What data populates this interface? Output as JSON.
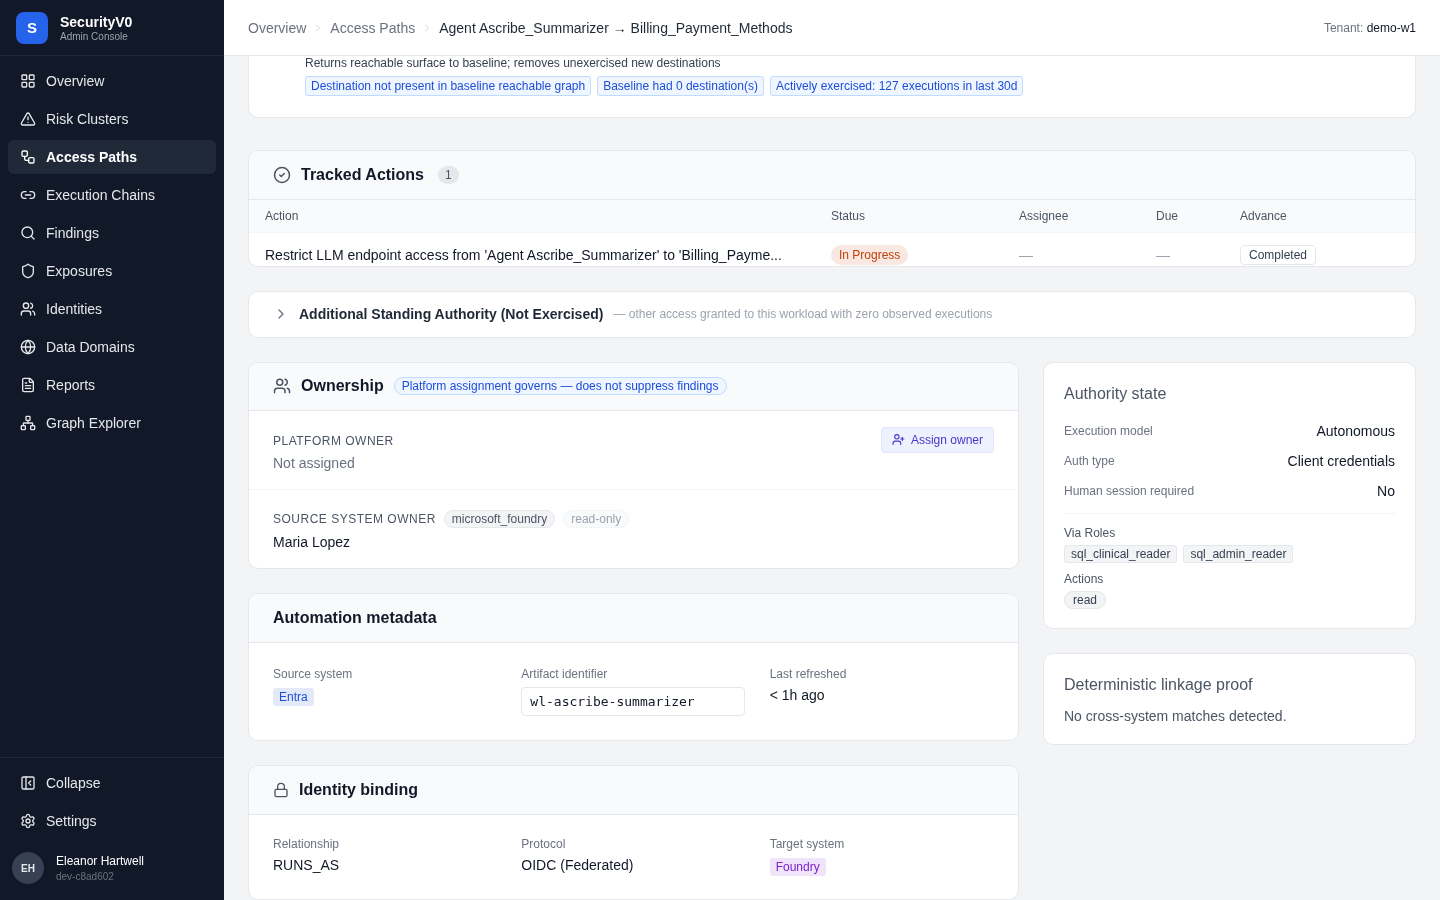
{
  "app": {
    "logo": "S",
    "name": "SecurityV0",
    "subtitle": "Admin Console"
  },
  "nav": [
    {
      "label": "Overview",
      "selected": false
    },
    {
      "label": "Risk Clusters",
      "selected": false
    },
    {
      "label": "Access Paths",
      "selected": true
    },
    {
      "label": "Execution Chains",
      "selected": false
    },
    {
      "label": "Findings",
      "selected": false
    },
    {
      "label": "Exposures",
      "selected": false
    },
    {
      "label": "Identities",
      "selected": false
    },
    {
      "label": "Data Domains",
      "selected": false
    },
    {
      "label": "Reports",
      "selected": false
    },
    {
      "label": "Graph Explorer",
      "selected": false
    }
  ],
  "footer_nav": [
    "Collapse",
    "Settings"
  ],
  "user": {
    "initials": "EH",
    "name": "Eleanor Hartwell",
    "id": "dev-c8ad602"
  },
  "breadcrumb": [
    {
      "label": "Overview",
      "kind": "link"
    },
    {
      "label": "Access Paths",
      "kind": "link"
    },
    {
      "label": "Agent Ascribe_Summarizer → Billing_Payment_Methods",
      "kind": "current"
    }
  ],
  "tenant": {
    "label": "Tenant:",
    "value": "demo-w1"
  },
  "remediation": {
    "description": "Returns reachable surface to baseline; removes unexercised new destinations",
    "tags": [
      "Destination not present in baseline reachable graph",
      "Baseline had 0 destination(s)",
      "Actively exercised: 127 executions in last 30d"
    ]
  },
  "tracked_actions": {
    "title": "Tracked Actions",
    "count": "1",
    "columns": [
      "Action",
      "Status",
      "Assignee",
      "Due",
      "Advance"
    ],
    "rows": [
      {
        "action": "Restrict LLM endpoint access from 'Agent Ascribe_Summarizer' to 'Billing_Payme...",
        "status": {
          "label": "In Progress",
          "color": "#c2410c"
        },
        "assignee": "—",
        "due": "—",
        "advance": "Completed"
      }
    ]
  },
  "standing_authority": {
    "title": "Additional Standing Authority (Not Exercised)",
    "subtitle": "— other access granted to this workload with zero observed executions",
    "expanded": false
  },
  "ownership": {
    "title": "Ownership",
    "note": "Platform assignment governs — does not suppress findings",
    "platform_owner": {
      "label": "PLATFORM OWNER",
      "value": "Not assigned",
      "action": "Assign owner"
    },
    "source_owner": {
      "label": "SOURCE SYSTEM OWNER",
      "tags": [
        {
          "label": "microsoft_foundry",
          "kind": "system"
        },
        {
          "label": "read-only",
          "kind": "muted"
        }
      ],
      "value": "Maria Lopez"
    }
  },
  "automation": {
    "title": "Automation metadata",
    "fields": [
      {
        "label": "Source system",
        "value": "Entra",
        "kind": "badge",
        "color": "#1d4ed8"
      },
      {
        "label": "Artifact identifier",
        "value": "wl-ascribe-summarizer",
        "kind": "code"
      },
      {
        "label": "Last refreshed",
        "value": "< 1h ago",
        "kind": "text"
      }
    ]
  },
  "identity_binding": {
    "title": "Identity binding",
    "fields": [
      {
        "label": "Relationship",
        "value": "RUNS_AS",
        "kind": "text"
      },
      {
        "label": "Protocol",
        "value": "OIDC (Federated)",
        "kind": "text"
      },
      {
        "label": "Target system",
        "value": "Foundry",
        "kind": "badge",
        "color": "#7e22ce"
      }
    ]
  },
  "authority_state": {
    "title": "Authority state",
    "rows": [
      {
        "label": "Execution model",
        "value": "Autonomous"
      },
      {
        "label": "Auth type",
        "value": "Client credentials"
      },
      {
        "label": "Human session required",
        "value": "No"
      }
    ],
    "roles_label": "Via Roles",
    "roles": [
      "sql_clinical_reader",
      "sql_admin_reader"
    ],
    "actions_label": "Actions",
    "actions": [
      "read"
    ]
  },
  "linkage": {
    "title": "Deterministic linkage proof",
    "text": "No cross-system matches detected."
  }
}
